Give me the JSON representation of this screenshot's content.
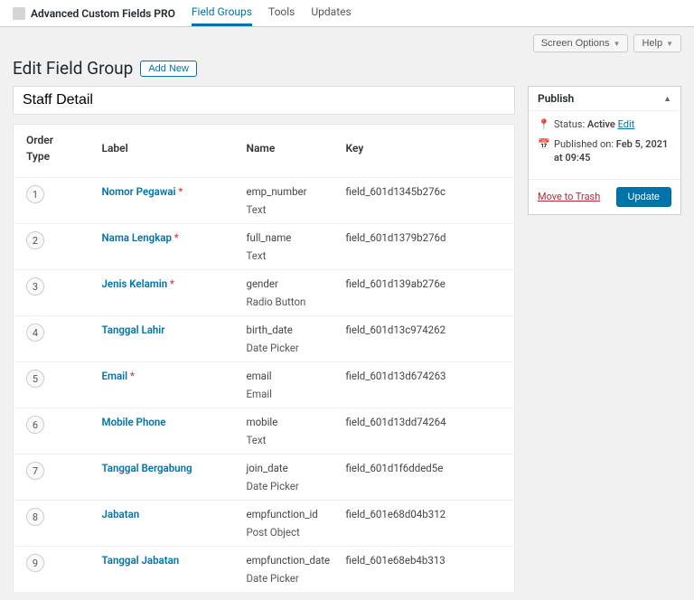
{
  "brand": "Advanced Custom Fields PRO",
  "nav": {
    "items": [
      "Field Groups",
      "Tools",
      "Updates"
    ]
  },
  "screen_options": "Screen Options",
  "help": "Help",
  "page_title": "Edit Field Group",
  "add_new": "Add New",
  "group_title": "Staff Detail",
  "columns": {
    "order": "Order",
    "label": "Label",
    "name": "Name",
    "type": "Type",
    "key": "Key"
  },
  "fields": [
    {
      "order": "1",
      "label": "Nomor Pegawai",
      "required": true,
      "name": "emp_number",
      "type": "Text",
      "key": "field_601d1345b276c"
    },
    {
      "order": "2",
      "label": "Nama Lengkap",
      "required": true,
      "name": "full_name",
      "type": "Text",
      "key": "field_601d1379b276d"
    },
    {
      "order": "3",
      "label": "Jenis Kelamin",
      "required": true,
      "name": "gender",
      "type": "Radio Button",
      "key": "field_601d139ab276e"
    },
    {
      "order": "4",
      "label": "Tanggal Lahir",
      "required": false,
      "name": "birth_date",
      "type": "Date Picker",
      "key": "field_601d13c974262"
    },
    {
      "order": "5",
      "label": "Email",
      "required": true,
      "name": "email",
      "type": "Email",
      "key": "field_601d13d674263"
    },
    {
      "order": "6",
      "label": "Mobile Phone",
      "required": false,
      "name": "mobile",
      "type": "Text",
      "key": "field_601d13dd74264"
    },
    {
      "order": "7",
      "label": "Tanggal Bergabung",
      "required": false,
      "name": "join_date",
      "type": "Date Picker",
      "key": "field_601d1f6dded5e"
    },
    {
      "order": "8",
      "label": "Jabatan",
      "required": false,
      "name": "empfunction_id",
      "type": "Post Object",
      "key": "field_601e68d04b312"
    },
    {
      "order": "9",
      "label": "Tanggal Jabatan",
      "required": false,
      "name": "empfunction_date",
      "type": "Date Picker",
      "key": "field_601e68eb4b313"
    }
  ],
  "publish": {
    "box_title": "Publish",
    "status_label": "Status:",
    "status_value": "Active",
    "edit": "Edit",
    "published_label": "Published on:",
    "published_value": "Feb 5, 2021 at 09:45",
    "trash": "Move to Trash",
    "update": "Update"
  }
}
